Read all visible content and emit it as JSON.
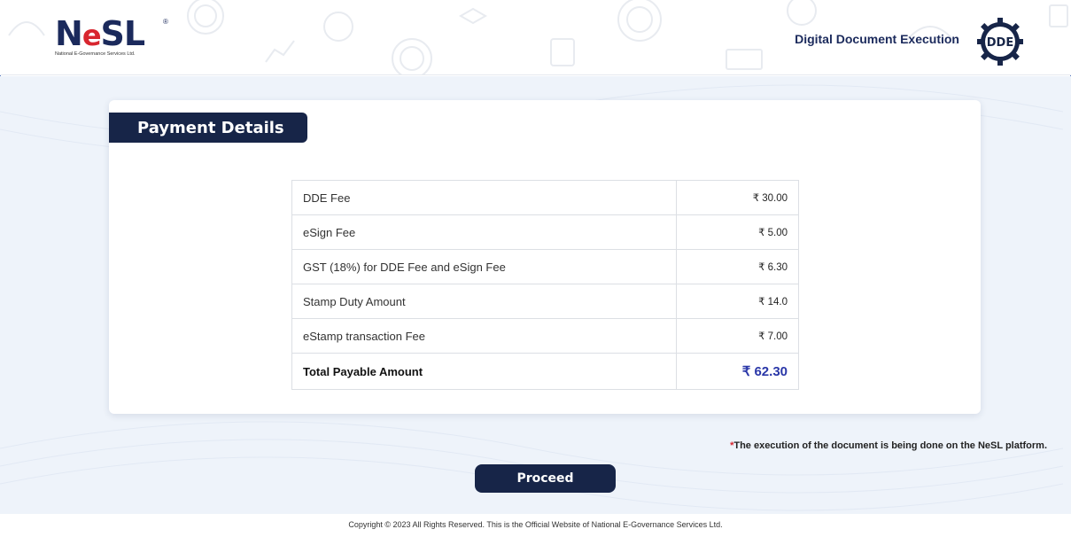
{
  "header": {
    "logo_text_n": "N",
    "logo_text_e": "e",
    "logo_text_sl": "SL",
    "logo_reg": "®",
    "logo_subtitle": "National E-Governance Services Ltd.",
    "app_title": "Digital Document Execution",
    "badge_text": "DDE"
  },
  "payment": {
    "section_title": "Payment Details",
    "rows": [
      {
        "label": "DDE Fee",
        "amount": "₹ 30.00"
      },
      {
        "label": "eSign Fee",
        "amount": "₹ 5.00"
      },
      {
        "label": "GST (18%) for DDE Fee and eSign Fee",
        "amount": "₹ 6.30"
      },
      {
        "label": "Stamp Duty Amount",
        "amount": "₹ 14.0"
      },
      {
        "label": "eStamp transaction Fee",
        "amount": "₹ 7.00"
      }
    ],
    "total_label": "Total Payable Amount",
    "total_amount": "₹ 62.30"
  },
  "note": {
    "asterisk": "*",
    "text": "The execution of the document is being done on the NeSL platform."
  },
  "proceed_label": "Proceed",
  "footer_text": "Copyright © 2023 All Rights Reserved. This is the Official Website of National E-Governance Services Ltd.",
  "colors": {
    "navy": "#172548",
    "brand_red": "#d8262f",
    "total_blue": "#2a37a8",
    "page_bg": "#eef3fa"
  }
}
